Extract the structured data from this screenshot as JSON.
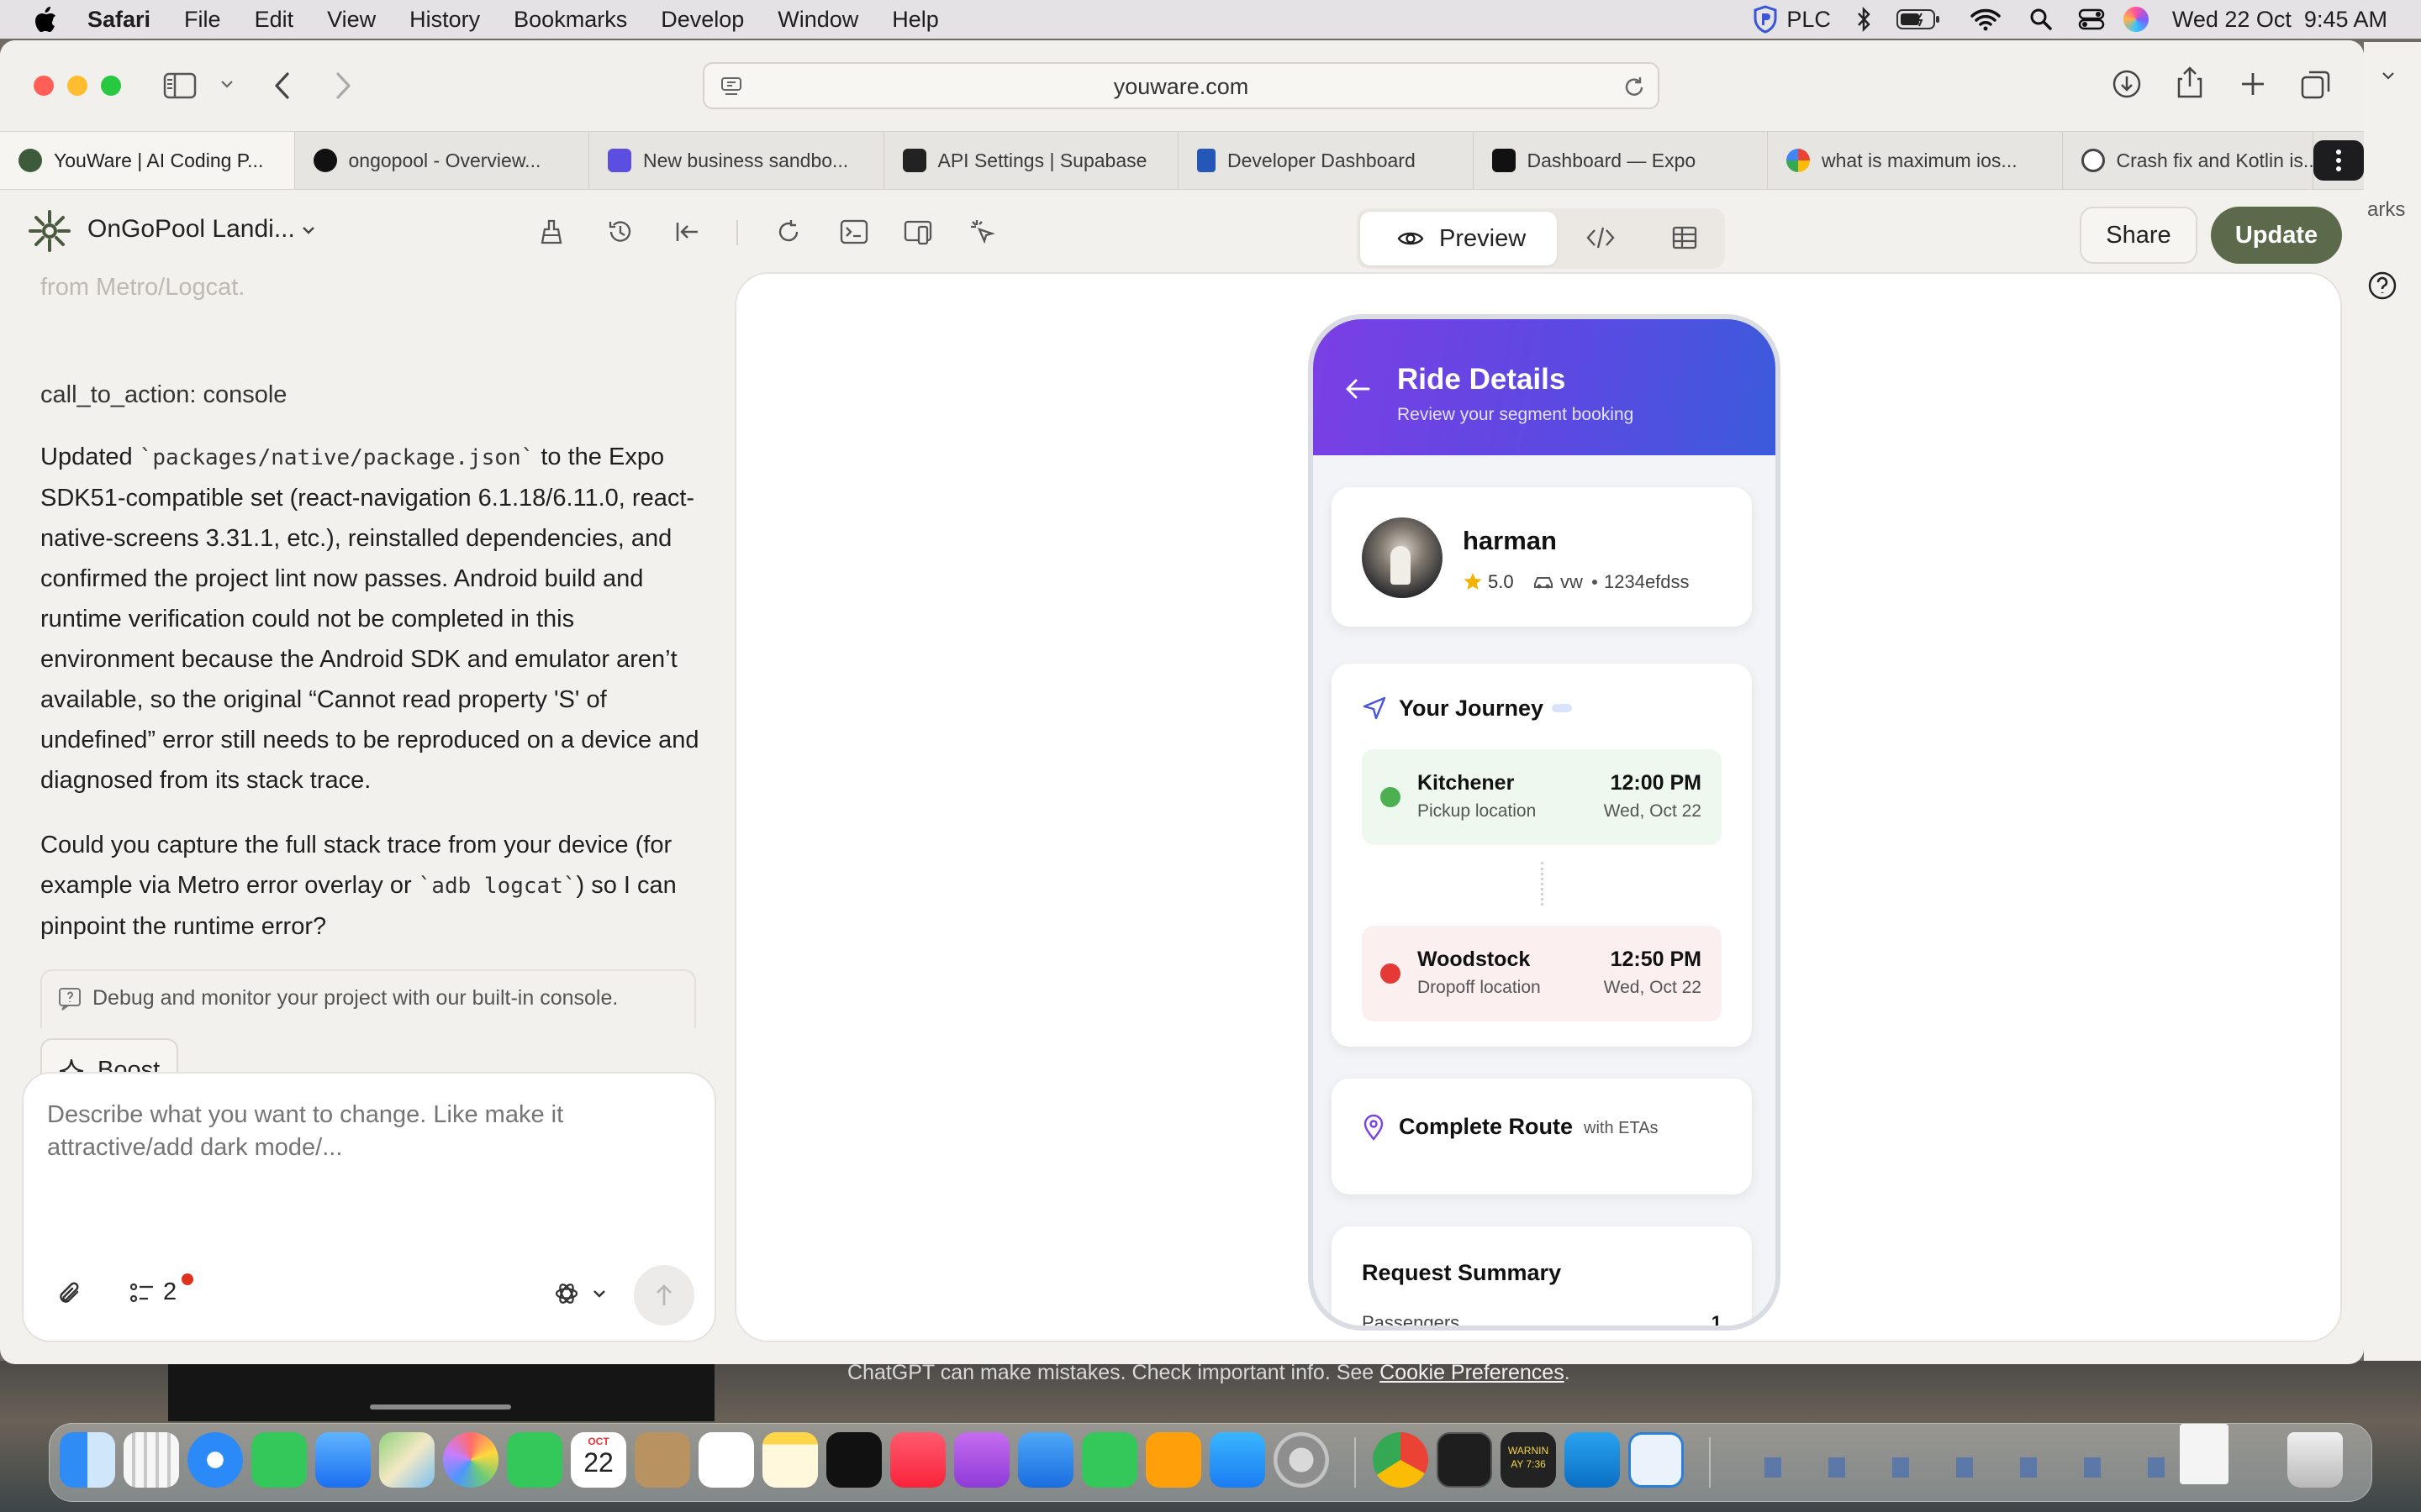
{
  "menubar": {
    "app": "Safari",
    "items": [
      "File",
      "Edit",
      "View",
      "History",
      "Bookmarks",
      "Develop",
      "Window",
      "Help"
    ],
    "vpn": "PLC",
    "datetime": "Wed 22 Oct  9:45 AM"
  },
  "browser": {
    "url": "youware.com",
    "tabs": [
      {
        "label": "YouWare | AI Coding P...",
        "color": "#3d5a3a"
      },
      {
        "label": "ongopool - Overview...",
        "color": "#111111"
      },
      {
        "label": "New business sandbo...",
        "color": "#5b4ee0"
      },
      {
        "label": "API Settings | Supabase",
        "color": "#222222"
      },
      {
        "label": "Developer Dashboard",
        "color": "#2457b8"
      },
      {
        "label": "Dashboard — Expo",
        "color": "#111111"
      },
      {
        "label": "what is maximum ios...",
        "color": "#ea4335"
      },
      {
        "label": "Crash fix and Kotlin is...",
        "color": "#444444"
      }
    ],
    "side_fragment": "arks"
  },
  "appbar": {
    "project": "OnGoPool Landi...",
    "preview_label": "Preview",
    "share_label": "Share",
    "update_label": "Update"
  },
  "chat": {
    "faded_line": "from Metro/Logcat.",
    "cta_line": "call_to_action: console",
    "para1_a": "Updated ",
    "para1_code": "`packages/native/package.json`",
    "para1_b": " to the Expo SDK51-compatible set (react-navigation 6.1.18/6.11.0, react-native-screens 3.31.1, etc.), reinstalled dependencies, and confirmed the project lint now passes. Android build and runtime verification could not be completed in this environment because the Android SDK and emulator aren’t available, so the original “Cannot read property 'S' of undefined” error still needs to be reproduced on a device and diagnosed from its stack trace.",
    "para2_a": "Could you capture the full stack trace from your device (for example via Metro error overlay or ",
    "para2_code": "`adb logcat`",
    "para2_b": ") so I can pinpoint the runtime error?",
    "console_hint": "Debug and monitor your project with our built-in console.",
    "boost_label": "Boost",
    "input_placeholder": "Describe what you want to change. Like make it attractive/add dark mode/...",
    "task_count": "2"
  },
  "phone": {
    "header_title": "Ride Details",
    "header_subtitle": "Review your segment booking",
    "driver_name": "harman",
    "rating": "5.0",
    "car": "vw",
    "plate": "1234efdss",
    "journey_title": "Your Journey",
    "pickup": {
      "city": "Kitchener",
      "label": "Pickup location",
      "time": "12:00 PM",
      "date": "Wed, Oct 22"
    },
    "dropoff": {
      "city": "Woodstock",
      "label": "Dropoff location",
      "time": "12:50 PM",
      "date": "Wed, Oct 22"
    },
    "route_title": "Complete Route",
    "route_sub": "with ETAs",
    "summary_title": "Request Summary",
    "passengers_label": "Passengers",
    "passengers_value": "1"
  },
  "background_text": {
    "disclaimer": "ChatGPT can make mistakes. Check important info. See ",
    "disclaimer_link": "Cookie Preferences",
    "disclaimer_end": "."
  },
  "dock": {
    "calendar_month": "OCT",
    "calendar_day": "22",
    "console_label": "WARNIN",
    "console_time": "AY 7:36"
  },
  "colors": {
    "accent_green": "#5a6a4a",
    "header_from": "#7b3fe4",
    "header_to": "#3b5bdb",
    "pickup_dot": "#4caf50",
    "dropoff_dot": "#e53935"
  }
}
